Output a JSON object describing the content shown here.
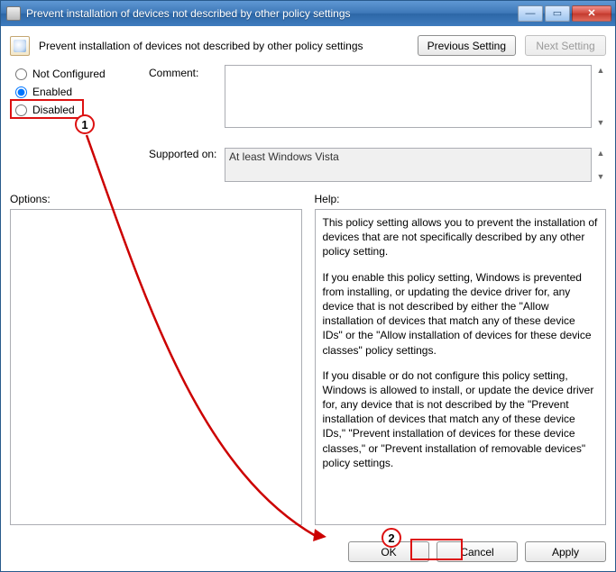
{
  "window": {
    "title": "Prevent installation of devices not described by other policy settings"
  },
  "header": {
    "policy_title": "Prevent installation of devices not described by other policy settings",
    "prev_btn": "Previous Setting",
    "next_btn": "Next Setting"
  },
  "radios": {
    "not_configured": "Not Configured",
    "enabled": "Enabled",
    "disabled": "Disabled",
    "selected": "enabled"
  },
  "labels": {
    "comment": "Comment:",
    "supported": "Supported on:",
    "options": "Options:",
    "help": "Help:"
  },
  "fields": {
    "comment_value": "",
    "supported_value": "At least Windows Vista"
  },
  "help": {
    "p1": "This policy setting allows you to prevent the installation of devices that are not specifically described by any other policy setting.",
    "p2": "If you enable this policy setting, Windows is prevented from installing, or updating the device driver for, any device that is not described by either the \"Allow installation of devices that match any of these device IDs\" or the \"Allow installation of devices for these device classes\" policy settings.",
    "p3": "If you disable or do not configure this policy setting, Windows is allowed to install, or update the device driver for, any device that is not described by the \"Prevent installation of devices that match any of these device IDs,\" \"Prevent installation of devices for these device classes,\" or \"Prevent installation of removable devices\" policy settings."
  },
  "footer": {
    "ok": "OK",
    "cancel": "Cancel",
    "apply": "Apply"
  },
  "annotations": {
    "badge1": "1",
    "badge2": "2"
  }
}
